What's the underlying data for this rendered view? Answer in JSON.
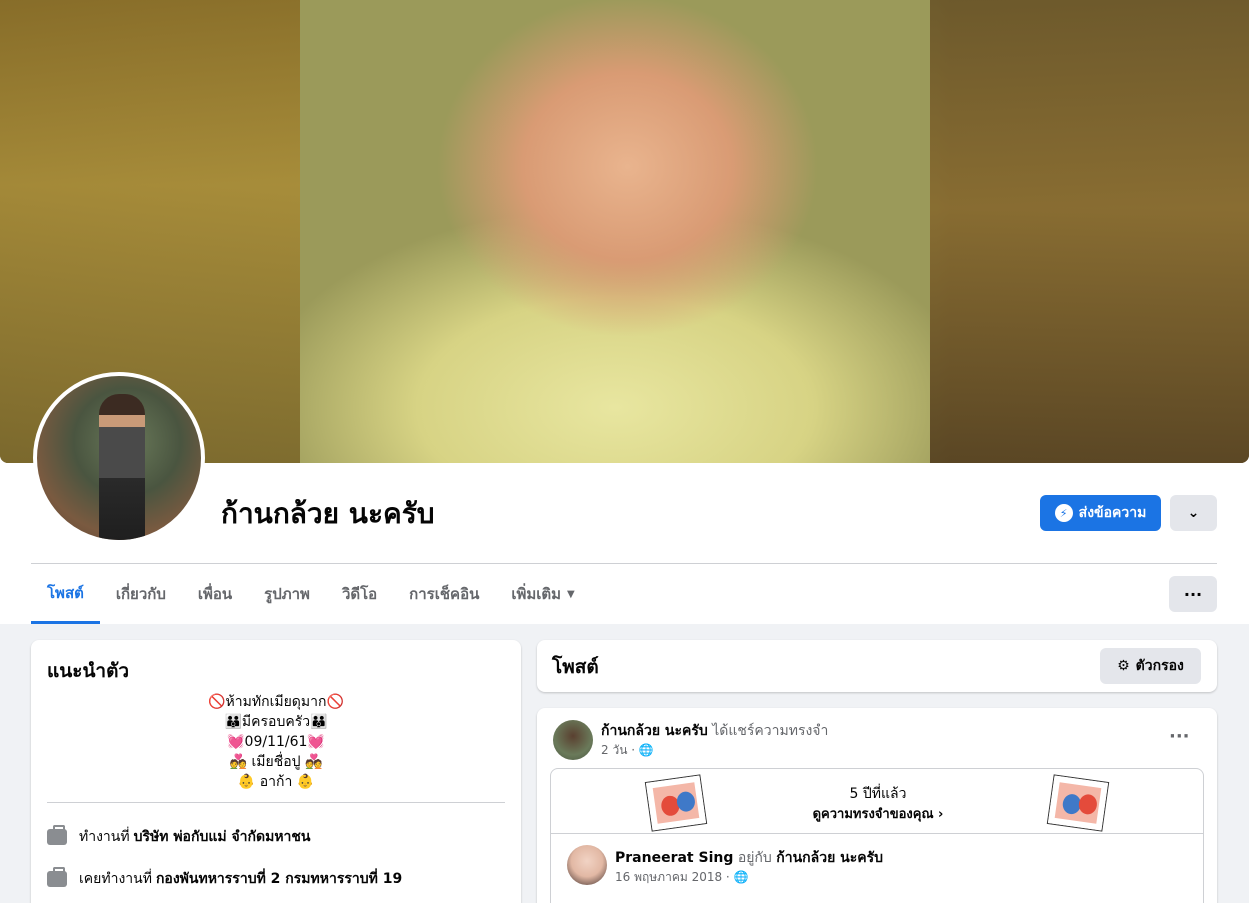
{
  "profile": {
    "name": "ก้านกล้วย นะครับ",
    "message_button": "ส่งข้อความ"
  },
  "tabs": [
    {
      "label": "โพสต์"
    },
    {
      "label": "เกี่ยวกับ"
    },
    {
      "label": "เพื่อน"
    },
    {
      "label": "รูปภาพ"
    },
    {
      "label": "วิดีโอ"
    },
    {
      "label": "การเช็คอิน"
    },
    {
      "label": "เพิ่มเติม"
    }
  ],
  "intro": {
    "title": "แนะนำตัว",
    "bio_lines": [
      "🚫ห้ามทักเมียดุมาก🚫",
      "👪มีครอบครัว👪",
      "💓09/11/61💓",
      "💑 เมียชื่อปู 💑",
      "👶 อาก้า 👶"
    ],
    "works_at_prefix": "ทำงานที่",
    "works_at": "บริษัท พ่อกับแม่ จำกัดมหาชน",
    "worked_at_prefix": "เคยทำงานที่",
    "worked_at": "กองพันทหารราบที่ 2 กรมทหารราบที่ 19"
  },
  "posts": {
    "title": "โพสต์",
    "filter_label": "ตัวกรอง"
  },
  "post": {
    "author": "ก้านกล้วย นะครับ",
    "action": "ได้แชร์ความทรงจำ",
    "time": "2 วัน ·",
    "memory_years": "5 ปีที่แล้ว",
    "memory_link": "ดูความทรงจำของคุณ",
    "inner_author": "Praneerat Sing",
    "inner_with": "อยู่กับ",
    "inner_tagged": "ก้านกล้วย นะครับ",
    "inner_date": "16 พฤษภาคม 2018 ·"
  },
  "colors": {
    "accent": "#1b74e4",
    "page_bg": "#f0f2f5"
  },
  "icons": {
    "messenger": "messenger-icon",
    "chevron": "chevron-down-icon",
    "more": "more-dots-icon",
    "filter": "filter-icon",
    "globe": "globe-icon",
    "briefcase": "briefcase-icon"
  }
}
